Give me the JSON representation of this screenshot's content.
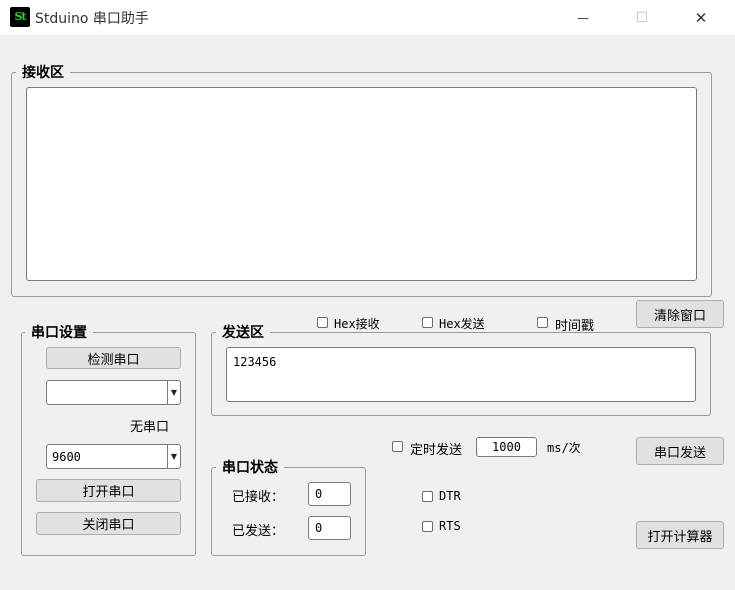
{
  "window": {
    "app_icon_text": "St",
    "title": "Stduino 串口助手",
    "minimize_glyph": "—",
    "maximize_glyph": "☐",
    "close_glyph": "✕"
  },
  "receive": {
    "legend": "接收区",
    "content": ""
  },
  "options": {
    "hex_receive": "Hex接收",
    "hex_send": "Hex发送",
    "timestamp": "时间戳"
  },
  "buttons": {
    "clear_window": "清除窗口",
    "serial_send": "串口发送",
    "open_calculator": "打开计算器"
  },
  "port_settings": {
    "legend": "串口设置",
    "detect_port": "检测串口",
    "port_value": "",
    "no_port": "无串口",
    "baud_value": "9600",
    "open_port": "打开串口",
    "close_port": "关闭串口"
  },
  "send": {
    "legend": "发送区",
    "content": "123456",
    "timed_send_label": "定时发送",
    "interval_value": "1000",
    "interval_unit": "ms/次"
  },
  "status": {
    "legend": "串口状态",
    "received_label": "已接收：",
    "received_value": "0",
    "sent_label": "已发送：",
    "sent_value": "0"
  },
  "signals": {
    "dtr": "DTR",
    "rts": "RTS"
  },
  "colors": {
    "window_bg": "#f0f0f0",
    "titlebar_bg": "#ffffff",
    "icon_green": "#2fd12f",
    "button_bg": "#e1e1e1"
  }
}
